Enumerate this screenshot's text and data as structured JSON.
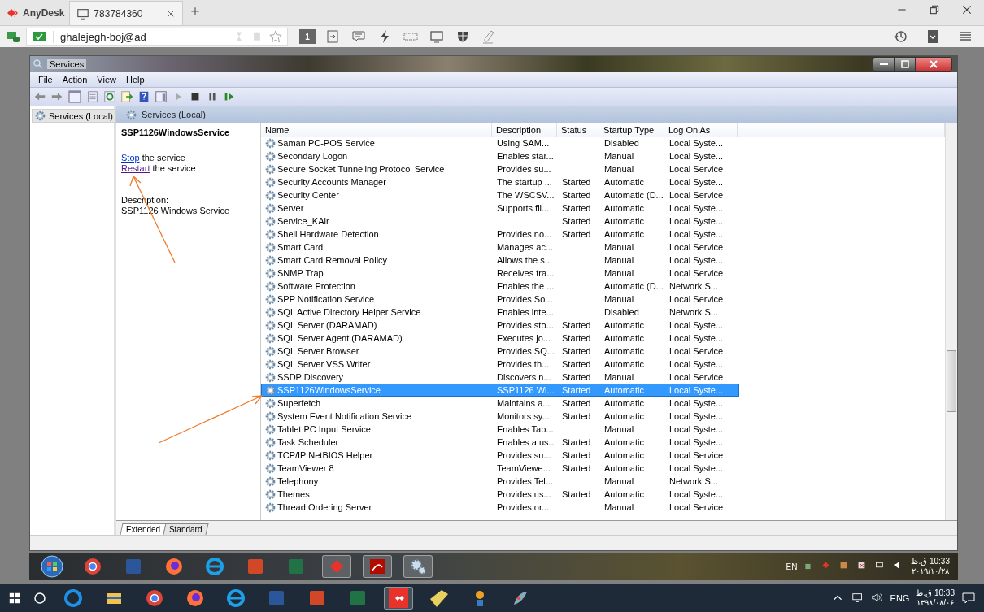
{
  "anydesk": {
    "brand": "AnyDesk",
    "tab": {
      "label": "783784360"
    },
    "address": "ghalejegh-boj@ad",
    "display_number": "1"
  },
  "services_window": {
    "title": "Services",
    "menu": [
      "File",
      "Action",
      "View",
      "Help"
    ],
    "tree": [
      {
        "label": "Services (Local)",
        "selected": true
      }
    ],
    "header": "Services (Local)",
    "detail": {
      "service_name": "SSP1126WindowsService",
      "actions": [
        {
          "link": "Stop",
          "text": " the service"
        },
        {
          "link": "Restart",
          "text": " the service"
        }
      ],
      "description_label": "Description:",
      "description": "SSP1126 Windows Service"
    },
    "table": {
      "columns": [
        "Name",
        "Description",
        "Status",
        "Startup Type",
        "Log On As"
      ],
      "rows": [
        {
          "name": "Saman PC-POS Service",
          "description": "Using SAM...",
          "startup_type": "Disabled",
          "log_on_as": "Local Syste...",
          "selected": false
        },
        {
          "name": "Secondary Logon",
          "description": "Enables star...",
          "startup_type": "Manual",
          "log_on_as": "Local Syste...",
          "selected": false
        },
        {
          "name": "Secure Socket Tunneling Protocol Service",
          "description": "Provides su...",
          "startup_type": "Manual",
          "log_on_as": "Local Service",
          "selected": false
        },
        {
          "name": "Security Accounts Manager",
          "description": "The startup ...",
          "status": "Started",
          "startup_type": "Automatic",
          "log_on_as": "Local Syste...",
          "selected": false
        },
        {
          "name": "Security Center",
          "description": "The WSCSV...",
          "status": "Started",
          "startup_type": "Automatic (D...",
          "log_on_as": "Local Service",
          "selected": false
        },
        {
          "name": "Server",
          "description": "Supports fil...",
          "status": "Started",
          "startup_type": "Automatic",
          "log_on_as": "Local Syste...",
          "selected": false
        },
        {
          "name": "Service_KAir",
          "status": "Started",
          "startup_type": "Automatic",
          "log_on_as": "Local Syste...",
          "selected": false
        },
        {
          "name": "Shell Hardware Detection",
          "description": "Provides no...",
          "status": "Started",
          "startup_type": "Automatic",
          "log_on_as": "Local Syste...",
          "selected": false
        },
        {
          "name": "Smart Card",
          "description": "Manages ac...",
          "startup_type": "Manual",
          "log_on_as": "Local Service",
          "selected": false
        },
        {
          "name": "Smart Card Removal Policy",
          "description": "Allows the s...",
          "startup_type": "Manual",
          "log_on_as": "Local Syste...",
          "selected": false
        },
        {
          "name": "SNMP Trap",
          "description": "Receives tra...",
          "startup_type": "Manual",
          "log_on_as": "Local Service",
          "selected": false
        },
        {
          "name": "Software Protection",
          "description": "Enables the ...",
          "startup_type": "Automatic (D...",
          "log_on_as": "Network S...",
          "selected": false
        },
        {
          "name": "SPP Notification Service",
          "description": "Provides So...",
          "startup_type": "Manual",
          "log_on_as": "Local Service",
          "selected": false
        },
        {
          "name": "SQL Active Directory Helper Service",
          "description": "Enables inte...",
          "startup_type": "Disabled",
          "log_on_as": "Network S...",
          "selected": false
        },
        {
          "name": "SQL Server (DARAMAD)",
          "description": "Provides sto...",
          "status": "Started",
          "startup_type": "Automatic",
          "log_on_as": "Local Syste...",
          "selected": false
        },
        {
          "name": "SQL Server Agent (DARAMAD)",
          "description": "Executes jo...",
          "status": "Started",
          "startup_type": "Automatic",
          "log_on_as": "Local Syste...",
          "selected": false
        },
        {
          "name": "SQL Server Browser",
          "description": "Provides SQ...",
          "status": "Started",
          "startup_type": "Automatic",
          "log_on_as": "Local Service",
          "selected": false
        },
        {
          "name": "SQL Server VSS Writer",
          "description": "Provides th...",
          "status": "Started",
          "startup_type": "Automatic",
          "log_on_as": "Local Syste...",
          "selected": false
        },
        {
          "name": "SSDP Discovery",
          "description": "Discovers n...",
          "status": "Started",
          "startup_type": "Manual",
          "log_on_as": "Local Service",
          "selected": false
        },
        {
          "name": "SSP1126WindowsService",
          "description": "SSP1126 Wi...",
          "status": "Started",
          "startup_type": "Automatic",
          "log_on_as": "Local Syste...",
          "selected": true
        },
        {
          "name": "Superfetch",
          "description": "Maintains a...",
          "status": "Started",
          "startup_type": "Automatic",
          "log_on_as": "Local Syste...",
          "selected": false
        },
        {
          "name": "System Event Notification Service",
          "description": "Monitors sy...",
          "status": "Started",
          "startup_type": "Automatic",
          "log_on_as": "Local Syste...",
          "selected": false
        },
        {
          "name": "Tablet PC Input Service",
          "description": "Enables Tab...",
          "startup_type": "Manual",
          "log_on_as": "Local Syste...",
          "selected": false
        },
        {
          "name": "Task Scheduler",
          "description": "Enables a us...",
          "status": "Started",
          "startup_type": "Automatic",
          "log_on_as": "Local Syste...",
          "selected": false
        },
        {
          "name": "TCP/IP NetBIOS Helper",
          "description": "Provides su...",
          "status": "Started",
          "startup_type": "Automatic",
          "log_on_as": "Local Service",
          "selected": false
        },
        {
          "name": "TeamViewer 8",
          "description": "TeamViewe...",
          "status": "Started",
          "startup_type": "Automatic",
          "log_on_as": "Local Syste...",
          "selected": false
        },
        {
          "name": "Telephony",
          "description": "Provides Tel...",
          "startup_type": "Manual",
          "log_on_as": "Network S...",
          "selected": false
        },
        {
          "name": "Themes",
          "description": "Provides us...",
          "status": "Started",
          "startup_type": "Automatic",
          "log_on_as": "Local Syste...",
          "selected": false
        },
        {
          "name": "Thread Ordering Server",
          "description": "Provides or...",
          "startup_type": "Manual",
          "log_on_as": "Local Service",
          "selected": false
        }
      ]
    },
    "view_tabs": [
      {
        "label": "Extended",
        "selected": true
      },
      {
        "label": "Standard",
        "selected": false
      }
    ]
  },
  "remote_taskbar": {
    "language": "EN",
    "time": "10:33 ق.ظ",
    "date": "۲۰۱۹/۱۰/۲۸"
  },
  "local_taskbar": {
    "language": "ENG",
    "time": "10:33 ق.ظ",
    "date": "۱۳۹۸/۰۸/۰۶"
  }
}
